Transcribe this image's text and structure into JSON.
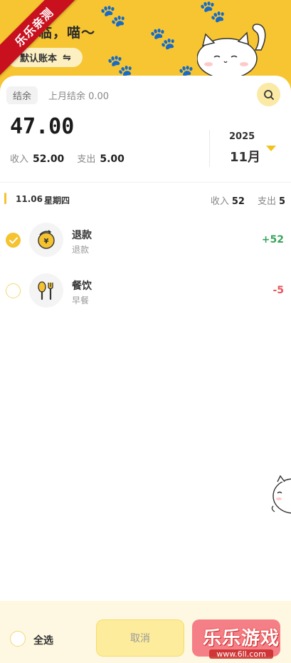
{
  "header": {
    "greeting": "光临，喵～",
    "account_label": "默认账本",
    "swap_icon": "⇋"
  },
  "badge": {
    "text": "乐乐亲测"
  },
  "summary": {
    "balance_tag": "结余",
    "last_month_label": "上月结余 0.00",
    "balance": "47.00",
    "income_label": "收入",
    "income_value": "52.00",
    "expense_label": "支出",
    "expense_value": "5.00",
    "year": "2025",
    "month": "11月"
  },
  "day": {
    "date": "11.06",
    "weekday": "星期四",
    "income_label": "收入",
    "income_value": "52",
    "expense_label": "支出",
    "expense_value": "5"
  },
  "records": [
    {
      "title": "退款",
      "subtitle": "退款",
      "amount": "+52",
      "icon": "coin-refund-icon",
      "checked": true
    },
    {
      "title": "餐饮",
      "subtitle": "早餐",
      "amount": "-5",
      "icon": "food-utensils-icon",
      "checked": false
    }
  ],
  "bottom": {
    "select_all": "全选",
    "cancel": "取消"
  },
  "watermark": {
    "title": "乐乐游戏",
    "url": "www.6ll.com"
  },
  "colors": {
    "accent": "#f7c531",
    "positive": "#3aa55c",
    "negative": "#e8545c",
    "delete": "#f57f86"
  }
}
